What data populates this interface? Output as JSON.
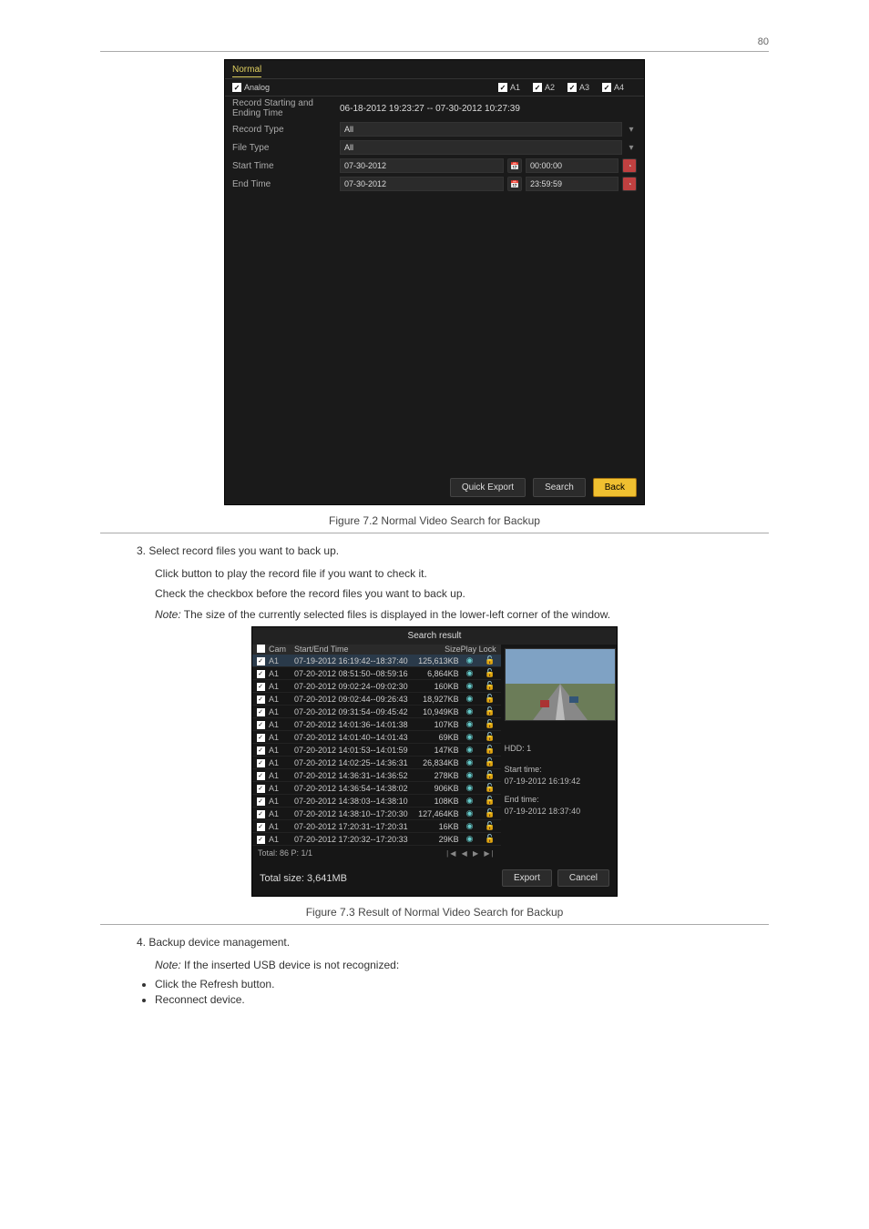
{
  "page_number": "80",
  "panel1": {
    "tab": "Normal",
    "analog_label": "Analog",
    "channels": [
      "A1",
      "A2",
      "A3",
      "A4"
    ],
    "rows": {
      "rec_se_label": "Record Starting and Ending Time",
      "rec_se_value": "06-18-2012 19:23:27  --  07-30-2012 10:27:39",
      "record_type_label": "Record Type",
      "record_type_value": "All",
      "file_type_label": "File Type",
      "file_type_value": "All",
      "start_time_label": "Start Time",
      "start_date": "07-30-2012",
      "start_time": "00:00:00",
      "end_time_label": "End Time",
      "end_date": "07-30-2012",
      "end_time": "23:59:59"
    },
    "buttons": {
      "quick_export": "Quick Export",
      "search": "Search",
      "back": "Back"
    }
  },
  "caption1": "Figure 7.2 Normal Video Search for Backup",
  "para1": "3. Select record files you want to back up.",
  "para1b": "Click button    to play the record file if you want to check it.",
  "para1c": "Check the checkbox before the record files you want to back up.",
  "note1_label": "Note:",
  "note1_text": " The size of the currently selected files is displayed in the lower-left corner of the window.",
  "panel2": {
    "title": "Search result",
    "head": {
      "cam": "Cam",
      "time": "Start/End Time",
      "size": "Size",
      "play": "Play",
      "lock": "Lock"
    },
    "rows": [
      {
        "cam": "A1",
        "time": "07-19-2012 16:19:42--18:37:40",
        "size": "125,613KB",
        "sel": true
      },
      {
        "cam": "A1",
        "time": "07-20-2012 08:51:50--08:59:16",
        "size": "6,864KB"
      },
      {
        "cam": "A1",
        "time": "07-20-2012 09:02:24--09:02:30",
        "size": "160KB"
      },
      {
        "cam": "A1",
        "time": "07-20-2012 09:02:44--09:26:43",
        "size": "18,927KB"
      },
      {
        "cam": "A1",
        "time": "07-20-2012 09:31:54--09:45:42",
        "size": "10,949KB"
      },
      {
        "cam": "A1",
        "time": "07-20-2012 14:01:36--14:01:38",
        "size": "107KB"
      },
      {
        "cam": "A1",
        "time": "07-20-2012 14:01:40--14:01:43",
        "size": "69KB"
      },
      {
        "cam": "A1",
        "time": "07-20-2012 14:01:53--14:01:59",
        "size": "147KB"
      },
      {
        "cam": "A1",
        "time": "07-20-2012 14:02:25--14:36:31",
        "size": "26,834KB"
      },
      {
        "cam": "A1",
        "time": "07-20-2012 14:36:31--14:36:52",
        "size": "278KB"
      },
      {
        "cam": "A1",
        "time": "07-20-2012 14:36:54--14:38:02",
        "size": "906KB"
      },
      {
        "cam": "A1",
        "time": "07-20-2012 14:38:03--14:38:10",
        "size": "108KB"
      },
      {
        "cam": "A1",
        "time": "07-20-2012 14:38:10--17:20:30",
        "size": "127,464KB"
      },
      {
        "cam": "A1",
        "time": "07-20-2012 17:20:31--17:20:31",
        "size": "16KB"
      },
      {
        "cam": "A1",
        "time": "07-20-2012 17:20:32--17:20:33",
        "size": "29KB"
      }
    ],
    "info": {
      "hdd": "HDD: 1",
      "start_label": "Start time:",
      "start_val": "07-19-2012 16:19:42",
      "end_label": "End time:",
      "end_val": "07-19-2012 18:37:40"
    },
    "status": "Total: 86  P: 1/1",
    "total": "Total size: 3,641MB",
    "export": "Export",
    "cancel": "Cancel"
  },
  "caption2": "Figure 7.3 Result of Normal Video Search for Backup",
  "para2": "4. Backup device management.",
  "note2a": "If the inserted USB device is not recognized:",
  "bullet1": "Click the Refresh button.",
  "bullet2": "Reconnect device."
}
